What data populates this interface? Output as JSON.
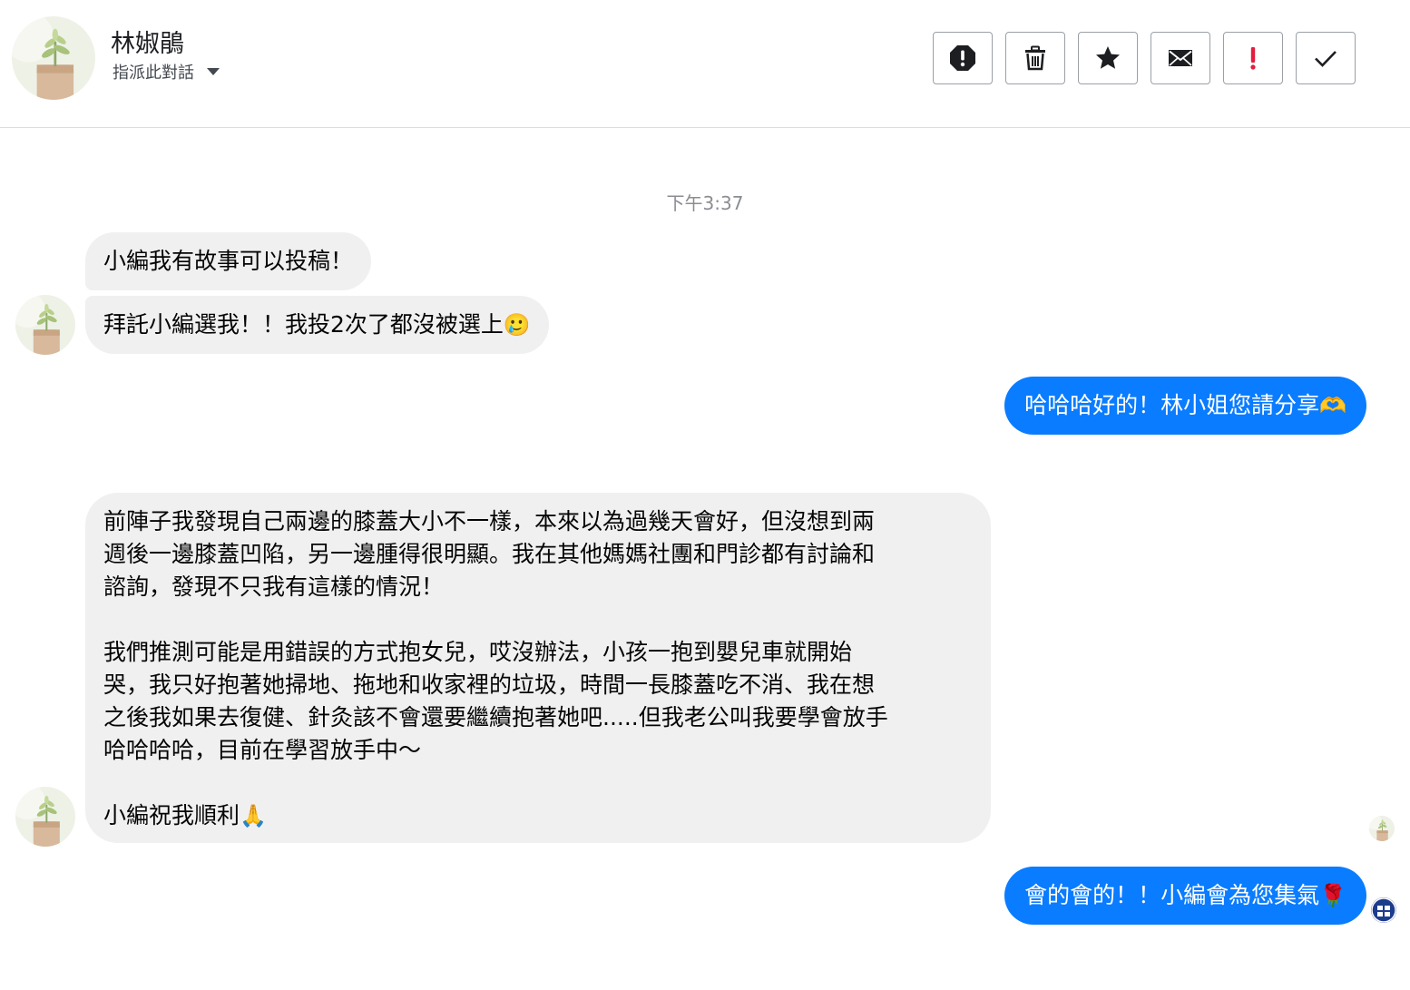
{
  "header": {
    "contact_name": "林婌鵑",
    "assign_label": "指派此對話",
    "actions": [
      {
        "name": "spam-button",
        "icon": "alert-octagon-icon"
      },
      {
        "name": "delete-button",
        "icon": "trash-icon"
      },
      {
        "name": "star-button",
        "icon": "star-icon"
      },
      {
        "name": "mark-unread-button",
        "icon": "envelope-icon"
      },
      {
        "name": "follow-up-button",
        "icon": "exclamation-icon"
      },
      {
        "name": "mark-done-button",
        "icon": "checkmark-icon"
      }
    ]
  },
  "conversation": {
    "timestamp": "下午3:37",
    "messages": [
      {
        "from": "contact",
        "text": "小編我有故事可以投稿！",
        "emoji": ""
      },
      {
        "from": "contact",
        "text": "拜託小編選我！！我投2次了都沒被選上",
        "emoji": "🥲"
      },
      {
        "from": "page",
        "text": "哈哈哈好的！林小姐您請分享",
        "emoji": "🫶"
      },
      {
        "from": "contact",
        "text": "前陣子我發現自己兩邊的膝蓋大小不一樣，本來以為過幾天會好，但沒想到兩\n週後一邊膝蓋凹陷，另一邊腫得很明顯。我在其他媽媽社團和門診都有討論和\n諮詢，發現不只我有這樣的情況！\n\n我們推測可能是用錯誤的方式抱女兒，哎沒辦法，小孩一抱到嬰兒車就開始\n哭，我只好抱著她掃地、拖地和收家裡的垃圾，時間一長膝蓋吃不消、我在想\n之後我如果去復健、針灸該不會還要繼續抱著她吧.....但我老公叫我要學會放手\n哈哈哈哈，目前在學習放手中～\n\n小編祝我順利",
        "emoji": "🙏"
      },
      {
        "from": "page",
        "text": "會的會的！！小編會為您集氣",
        "emoji": "🌹"
      }
    ]
  },
  "colors": {
    "outgoing_bubble": "#0a7cff",
    "incoming_bubble": "#f0f0f0",
    "follow_up_accent": "#e41e3f"
  }
}
